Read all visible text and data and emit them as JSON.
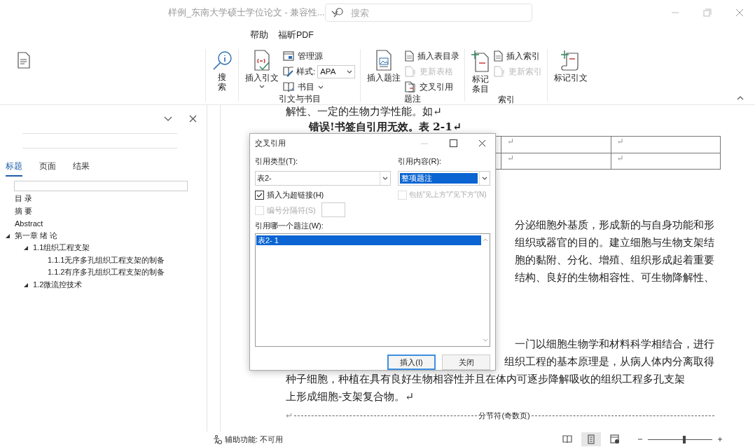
{
  "title_bar": {
    "title": "样例_东南大学硕士学位论文 - 兼容性...",
    "search": {
      "placeholder": "搜索"
    }
  },
  "menu": [
    {
      "label": "帮助"
    },
    {
      "label": "福昕PDF"
    }
  ],
  "ribbon": {
    "search_button": {
      "label": "搜索"
    },
    "groups": [
      {
        "label": "引文与书目",
        "large": [
          {
            "label": "插入引文",
            "caret": true
          }
        ],
        "small": [
          {
            "label": "管理源",
            "kind": "button",
            "disabled": false
          },
          {
            "label": "样式:",
            "kind": "dropdown",
            "value": "APA"
          },
          {
            "label": "书目",
            "kind": "menu",
            "disabled": false
          }
        ]
      },
      {
        "label": "题注",
        "large": [
          {
            "label": "插入题注",
            "caret": false
          }
        ],
        "small": [
          {
            "label": "插入表目录",
            "kind": "button",
            "disabled": false
          },
          {
            "label": "更新表格",
            "kind": "button",
            "disabled": true
          },
          {
            "label": "交叉引用",
            "kind": "button",
            "disabled": false
          }
        ]
      },
      {
        "label": "索引",
        "large": [
          {
            "label": "标记条目",
            "caret": false
          }
        ],
        "small": [
          {
            "label": "插入索引",
            "kind": "button",
            "disabled": false
          },
          {
            "label": "更新索引",
            "kind": "button",
            "disabled": true
          }
        ]
      },
      {
        "large": [
          {
            "label": "标记引文",
            "caret": false
          }
        ]
      }
    ]
  },
  "nav_pane": {
    "tabs": [
      {
        "label": "标题",
        "selected": true
      },
      {
        "label": "页面",
        "selected": false
      },
      {
        "label": "结果",
        "selected": false
      }
    ],
    "tree": [
      {
        "label": "目 录"
      },
      {
        "label": "摘 要"
      },
      {
        "label": "Abstract"
      },
      {
        "label": "第一章 绪 论",
        "expanded": true,
        "children": [
          {
            "label": "1.1组织工程支架",
            "expanded": true,
            "children": [
              {
                "label": "1.1.1无序多孔组织工程支架的制备"
              },
              {
                "label": "1.1.2有序多孔组织工程支架的制备"
              }
            ]
          },
          {
            "label": "1.2微流控技术",
            "expanded": true
          }
        ]
      }
    ]
  },
  "document": {
    "lines": [
      {
        "kind": "text",
        "text": "解性、一定的生物力学性能。如↵"
      },
      {
        "kind": "bold",
        "text": "错误!书签自引用无效。表 2-1↵"
      },
      {
        "kind": "table",
        "rows": [
          [
            "↵",
            "↵"
          ],
          [
            "↵",
            "↵"
          ]
        ]
      },
      {
        "kind": "fragment",
        "text": "分泌细胞外基质，形成新的与自身功能和形"
      },
      {
        "kind": "fragment",
        "text": "组织或器官的目的。建立细胞与生物支架结"
      },
      {
        "kind": "fragment",
        "text": "胞的黏附、分化、增殖、组织形成起着重要"
      },
      {
        "kind": "fragment",
        "text": "结构、良好的生物相容性、可生物降解性、"
      },
      {
        "kind": "fragment",
        "text": "一门以细胞生物学和材料科学相结合，进行"
      },
      {
        "kind": "fragment",
        "text": "组织工程的基本原理是，从病人体内分离取得"
      },
      {
        "kind": "text",
        "text": "种子细胞，种植在具有良好生物相容性并且在体内可逐步降解吸收的组织工程多孔支架"
      },
      {
        "kind": "text",
        "text": "上形成细胞-支架复合物。↵"
      },
      {
        "kind": "break",
        "mark": "↵",
        "text": "分节符(奇数页)"
      }
    ]
  },
  "dialog": {
    "title": "交叉引用",
    "type_label": "引用类型(T):",
    "type_value": "表2-",
    "content_label": "引用内容(R):",
    "content_value": "整项题注",
    "checks": [
      {
        "label": "插入为超链接(H)",
        "checked": true,
        "disabled": false
      },
      {
        "label": "包括\"见上方\"/\"见下方\"(N)",
        "checked": false,
        "disabled": true
      },
      {
        "label": "编号分隔符(S)",
        "checked": false,
        "disabled": true
      }
    ],
    "list_label": "引用哪一个题注(W):",
    "items": [
      {
        "label": "表2- 1",
        "selected": true
      }
    ],
    "buttons": [
      {
        "label": "插入(I)",
        "focused": true
      },
      {
        "label": "关闭",
        "focused": false
      }
    ]
  },
  "status_bar": {
    "accessibility": "辅助功能: 不可用",
    "views": [
      {
        "selected": false
      },
      {
        "selected": true
      },
      {
        "selected": false
      }
    ],
    "zoom": {
      "level": 0.56
    }
  }
}
